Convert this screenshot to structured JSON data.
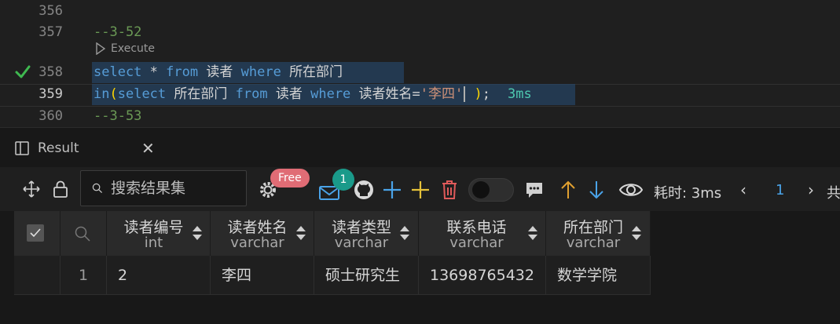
{
  "editor": {
    "lines": [
      {
        "number": "356"
      },
      {
        "number": "357",
        "comment": "--3-52"
      },
      {
        "number": "358",
        "kw1": "select",
        "star": "*",
        "kw2": "from",
        "table": "读者",
        "kw3": "where",
        "field": "所在部门"
      },
      {
        "number": "359",
        "kw1": "in",
        "paren_open": "(",
        "kw2": "select",
        "field": "所在部门",
        "kw3": "from",
        "table": "读者",
        "kw4": "where",
        "cond_field": "读者姓名=",
        "str": "'李四'",
        "paren_close": ")",
        "semicolon": ";",
        "timing": "3ms"
      },
      {
        "number": "360",
        "comment": "--3-53"
      }
    ],
    "codelens": "Execute"
  },
  "panel": {
    "tab_label": "Result",
    "search_placeholder": "搜索结果集",
    "free_badge": "Free",
    "notification_count": "1",
    "elapsed": "耗时: 3ms",
    "page_number": "1",
    "total_prefix": "共",
    "colors": {
      "accent_plus": "#4aa3e8",
      "accent_yellow": "#e5c13a",
      "delete_red": "#e05a5a",
      "up_arrow": "#e0a030",
      "down_arrow": "#4aa3e8"
    }
  },
  "table": {
    "columns": [
      {
        "name": "读者编号",
        "type": "int"
      },
      {
        "name": "读者姓名",
        "type": "varchar"
      },
      {
        "name": "读者类型",
        "type": "varchar"
      },
      {
        "name": "联系电话",
        "type": "varchar"
      },
      {
        "name": "所在部门",
        "type": "varchar"
      }
    ],
    "rows": [
      {
        "index": "1",
        "cells": [
          "2",
          "李四",
          "硕士研究生",
          "13698765432",
          "数学学院"
        ]
      }
    ]
  }
}
